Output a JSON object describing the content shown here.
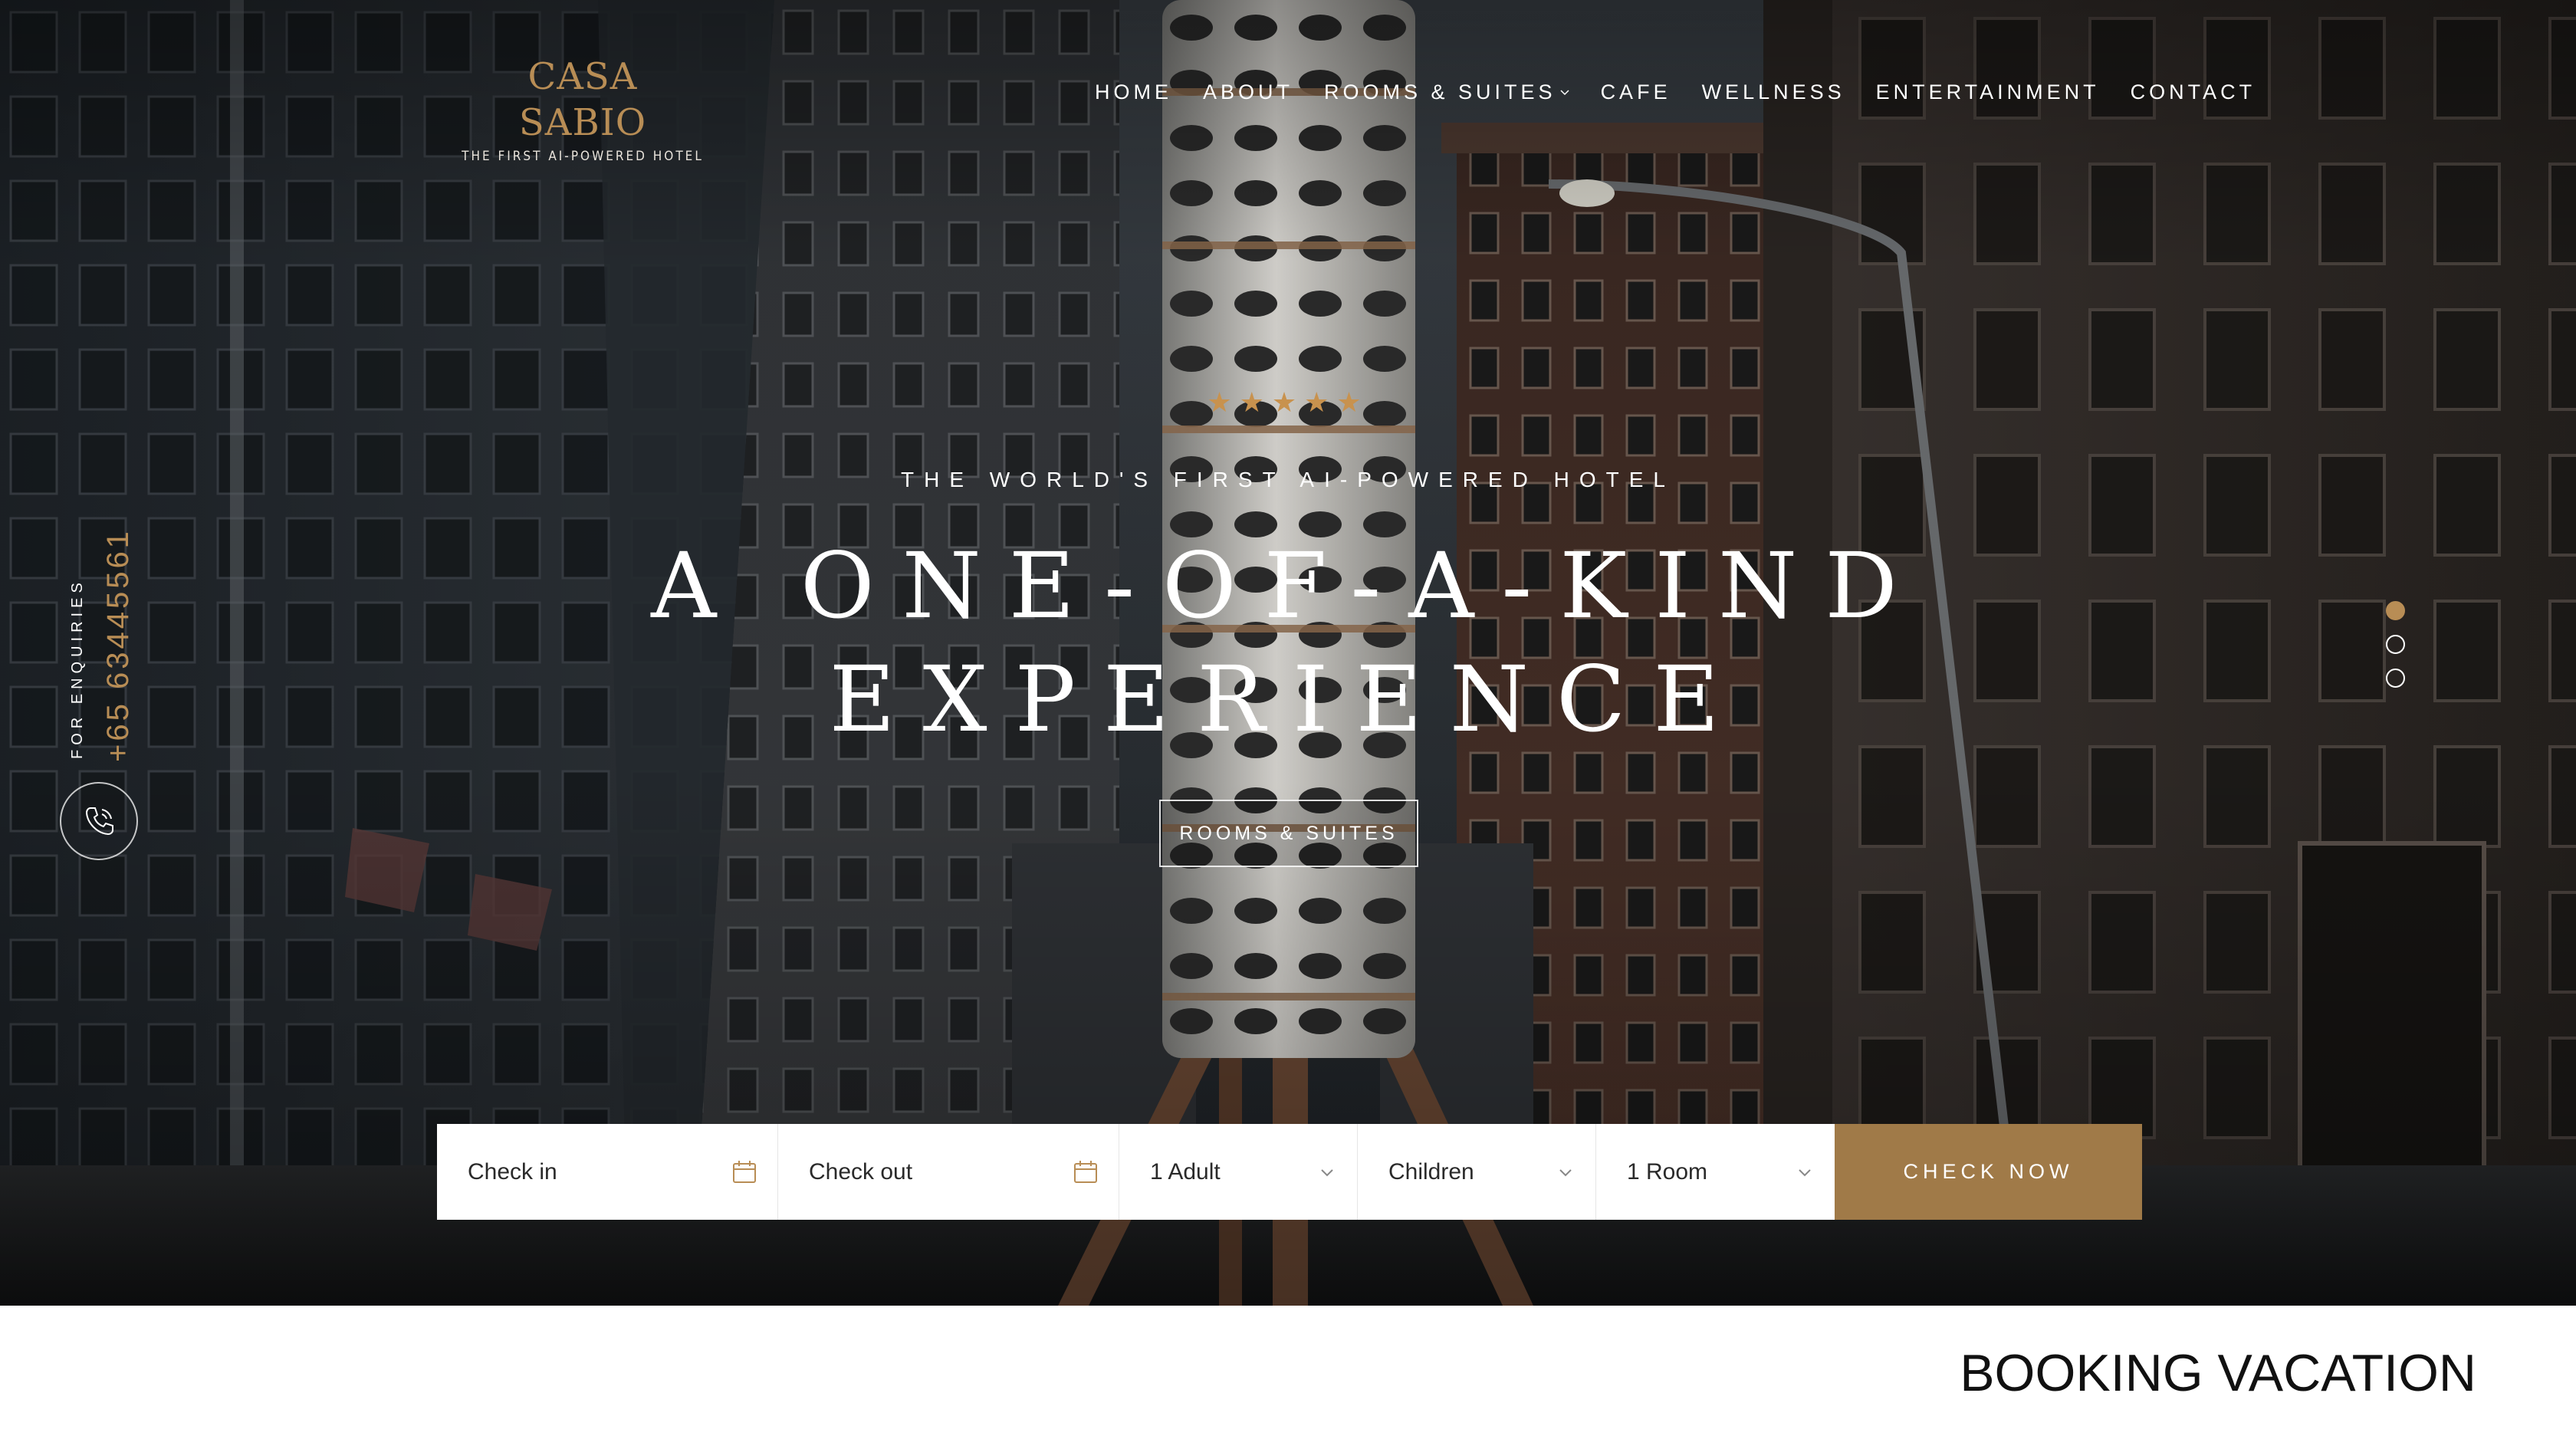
{
  "brand": {
    "name": "CASA SABIO",
    "tagline": "THE FIRST AI-POWERED HOTEL"
  },
  "nav": {
    "items": [
      {
        "label": "HOME"
      },
      {
        "label": "ABOUT"
      },
      {
        "label": "ROOMS & SUITES",
        "has_dropdown": true
      },
      {
        "label": "CAFE"
      },
      {
        "label": "WELLNESS"
      },
      {
        "label": "ENTERTAINMENT"
      },
      {
        "label": "CONTACT"
      }
    ]
  },
  "side": {
    "enquiries_label": "FOR ENQUIRIES",
    "phone": "+65 63445561",
    "phone_icon": "phone-icon"
  },
  "hero": {
    "rating_stars": "★★★★★",
    "rating_value": 5,
    "eyebrow": "THE WORLD'S FIRST AI-POWERED HOTEL",
    "headline_line1": "A ONE-OF-A-KIND",
    "headline_line2": "EXPERIENCE",
    "cta_label": "ROOMS & SUITES",
    "slider": {
      "total": 3,
      "active_index": 0
    }
  },
  "booking": {
    "check_in": "Check in",
    "check_out": "Check out",
    "adults": "1 Adult",
    "children": "Children",
    "rooms": "1 Room",
    "submit_label": "CHECK NOW",
    "calendar_icon": "calendar-icon",
    "dropdown_icon": "chevron-down-icon"
  },
  "section": {
    "title": "BOOKING VACATION"
  },
  "colors": {
    "accent": "#b88d55",
    "button": "#a07a48",
    "white": "#ffffff",
    "dark_text": "#111111"
  }
}
